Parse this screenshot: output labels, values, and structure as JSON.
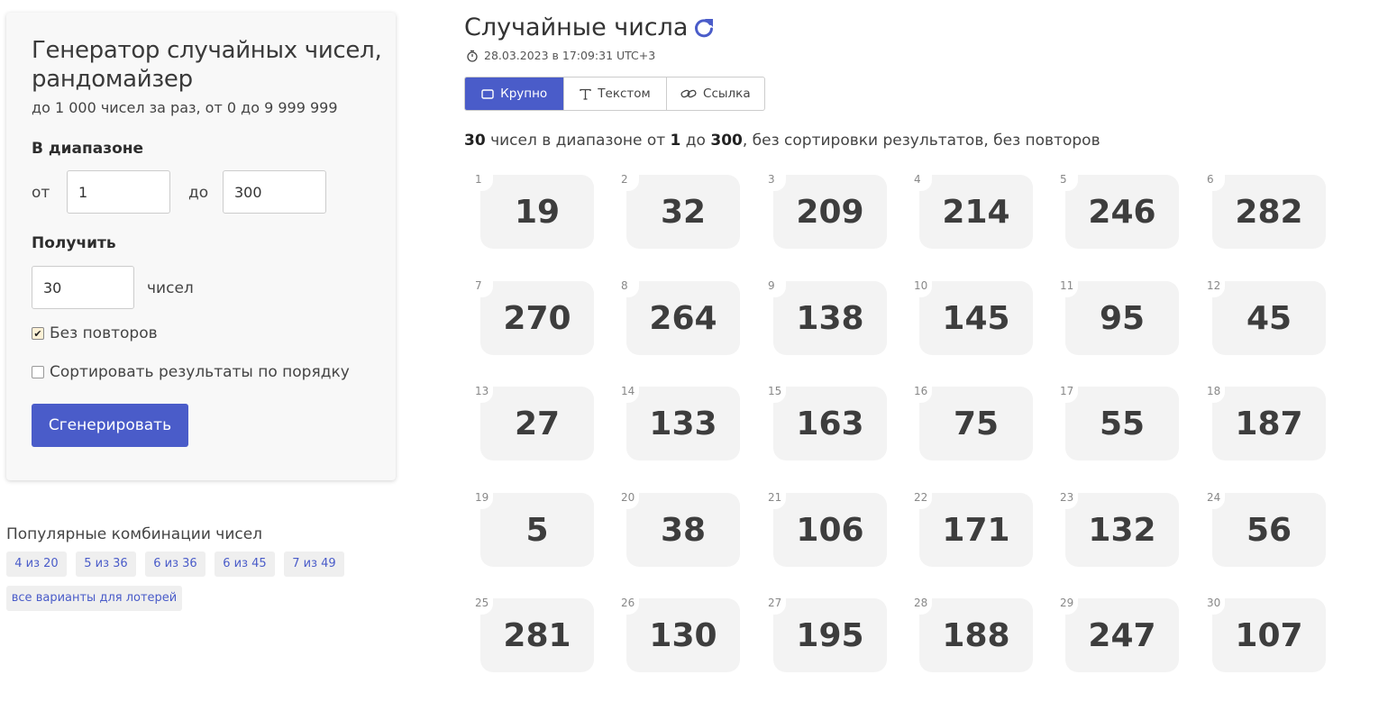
{
  "panel": {
    "title": "Генератор случайных чисел, рандомайзер",
    "subtitle": "до 1 000 чисел за раз, от 0 до 9 999 999",
    "range_label": "В диапазоне",
    "from_label": "от",
    "from_value": "1",
    "to_label": "до",
    "to_value": "300",
    "get_label": "Получить",
    "count_value": "30",
    "count_suffix": "чисел",
    "no_repeats_label": "Без повторов",
    "no_repeats_checked": true,
    "sort_label": "Сортировать результаты по порядку",
    "sort_checked": false,
    "generate_button": "Сгенерировать"
  },
  "popular": {
    "title": "Популярные комбинации чисел",
    "chips": [
      "4 из 20",
      "5 из 36",
      "6 из 36",
      "6 из 45",
      "7 из 49"
    ],
    "all_lotteries": "все варианты для лотерей"
  },
  "results": {
    "title": "Случайные числа",
    "refresh_icon": "refresh-icon",
    "timestamp": "28.03.2023 в 17:09:31 UTC+3",
    "tabs": [
      {
        "label": "Крупно",
        "icon": "rectangle-icon",
        "active": true
      },
      {
        "label": "Текстом",
        "icon": "text-icon",
        "active": false
      },
      {
        "label": "Ссылка",
        "icon": "link-icon",
        "active": false
      }
    ],
    "summary": {
      "count": "30",
      "part1": " чисел в диапазоне от ",
      "from": "1",
      "part2": " до ",
      "to": "300",
      "part3": ", без сортировки результатов, без повторов"
    },
    "numbers": [
      19,
      32,
      209,
      214,
      246,
      282,
      270,
      264,
      138,
      145,
      95,
      45,
      27,
      133,
      163,
      75,
      55,
      187,
      5,
      38,
      106,
      171,
      132,
      56,
      281,
      130,
      195,
      188,
      247,
      107
    ]
  },
  "colors": {
    "accent": "#4a5cc9",
    "card_bg": "#f3f3f3",
    "panel_bg": "#f8f8f8"
  }
}
